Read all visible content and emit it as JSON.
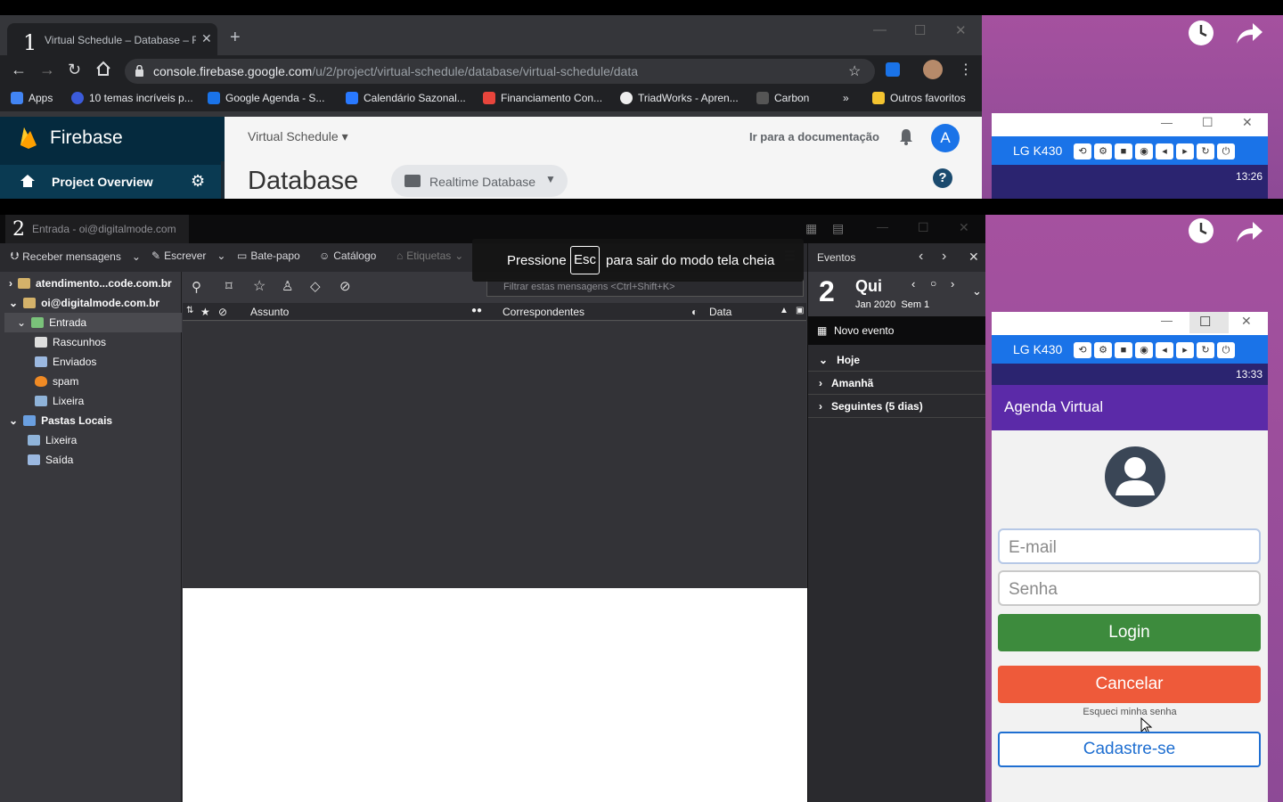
{
  "browser": {
    "tab_number": "1",
    "tab_title": "Virtual Schedule – Database – Fi",
    "url_host": "console.firebase.google.com",
    "url_path": "/u/2/project/virtual-schedule/database/virtual-schedule/data",
    "bookmarks": [
      {
        "label": "Apps",
        "color": "#4285f4"
      },
      {
        "label": "10 temas incríveis p...",
        "color": "#3b5bdb"
      },
      {
        "label": "Google Agenda - S...",
        "color": "#1a73e8"
      },
      {
        "label": "Calendário Sazonal...",
        "color": "#2979ff"
      },
      {
        "label": "Financiamento Con...",
        "color": "#e8453c"
      },
      {
        "label": "TriadWorks - Apren...",
        "color": "#444444"
      },
      {
        "label": "Carbon",
        "color": "#222222"
      }
    ],
    "bookmarks_more": "»",
    "other_bookmarks": "Outros favoritos"
  },
  "firebase": {
    "brand": "Firebase",
    "project_overview": "Project Overview",
    "project_name": "Virtual Schedule",
    "docs_link": "Ir para a documentação",
    "avatar_letter": "A",
    "page_title": "Database",
    "db_selector": "Realtime Database",
    "accent": "#1a73e8"
  },
  "phone_top": {
    "device": "LG K430",
    "time": "13:26"
  },
  "thunderbird": {
    "window_number": "2",
    "window_title": "Entrada - oi@digitalmode.com",
    "toolbar": {
      "receive": "Receber mensagens",
      "write": "Escrever",
      "chat": "Bate-papo",
      "catalog": "Catálogo",
      "tags": "Etiquetas"
    },
    "filter_placeholder": "Filtrar estas mensagens <Ctrl+Shift+K>",
    "columns": {
      "subject": "Assunto",
      "correspondents": "Correspondentes",
      "date": "Data"
    },
    "folders": [
      {
        "label": "atendimento...code.com.br",
        "level": 0,
        "bold": true,
        "icon": "account",
        "toggle": "›"
      },
      {
        "label": "oi@digitalmode.com.br",
        "level": 0,
        "bold": true,
        "icon": "account",
        "toggle": "⌄"
      },
      {
        "label": "Entrada",
        "level": 1,
        "bold": false,
        "icon": "inbox",
        "toggle": "⌄",
        "selected": true
      },
      {
        "label": "Rascunhos",
        "level": 2,
        "bold": false,
        "icon": "drafts",
        "toggle": ""
      },
      {
        "label": "Enviados",
        "level": 2,
        "bold": false,
        "icon": "sent",
        "toggle": ""
      },
      {
        "label": "spam",
        "level": 2,
        "bold": false,
        "icon": "spam",
        "toggle": ""
      },
      {
        "label": "Lixeira",
        "level": 2,
        "bold": false,
        "icon": "trash",
        "toggle": ""
      },
      {
        "label": "Pastas Locais",
        "level": 0,
        "bold": true,
        "icon": "local",
        "toggle": "⌄"
      },
      {
        "label": "Lixeira",
        "level": 1,
        "bold": false,
        "icon": "trash",
        "toggle": ""
      },
      {
        "label": "Saída",
        "level": 1,
        "bold": false,
        "icon": "outbox",
        "toggle": ""
      }
    ],
    "events": {
      "title": "Eventos",
      "day_number": "2",
      "weekday": "Qui",
      "month_week": "Jan 2020  Sem 1",
      "new_event": "Novo evento",
      "groups": [
        "Hoje",
        "Amanhã",
        "Seguintes (5 dias)"
      ]
    }
  },
  "fullscreen_notice": {
    "before": "Pressione",
    "key": "Esc",
    "after": "para sair do modo tela cheia"
  },
  "phone_bottom": {
    "device": "LG K430",
    "time": "13:33",
    "app_title": "Agenda Virtual",
    "email_placeholder": "E-mail",
    "password_placeholder": "Senha",
    "login": "Login",
    "cancel": "Cancelar",
    "forgot": "Esqueci minha senha",
    "register": "Cadastre-se",
    "colors": {
      "appbar": "#5b2aa8",
      "login": "#3d8b3d",
      "cancel": "#ee5a3a",
      "register": "#1f6fd1"
    }
  }
}
